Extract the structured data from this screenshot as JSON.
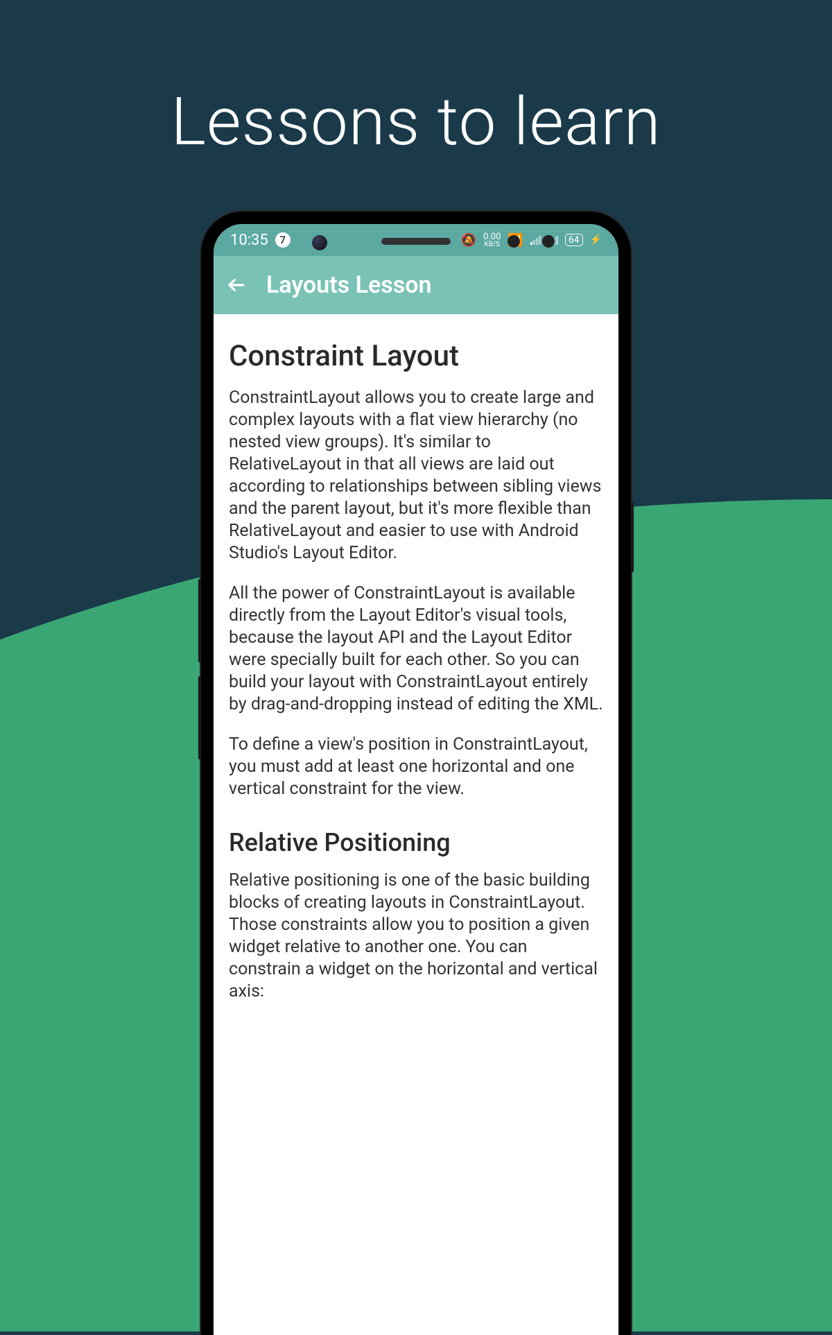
{
  "hero": {
    "title": "Lessons to learn"
  },
  "status": {
    "time": "10:35",
    "notification_count": "7",
    "data_rate": "0.00",
    "data_unit": "KB/S",
    "battery": "64",
    "charging": "⚡"
  },
  "appbar": {
    "title": "Layouts Lesson"
  },
  "lesson": {
    "heading": "Constraint Layout",
    "p1": "ConstraintLayout allows you to create large and complex layouts with a flat view hierarchy (no nested view groups). It's similar to RelativeLayout in that all views are laid out according to relationships between sibling views and the parent layout, but it's more flexible than RelativeLayout and easier to use with Android Studio's Layout Editor.",
    "p2": "All the power of ConstraintLayout is available directly from the Layout Editor's visual tools, because the layout API and the Layout Editor were specially built for each other. So you can build your layout with ConstraintLayout entirely by drag-and-dropping instead of editing the XML.",
    "p3": "To define a view's position in ConstraintLayout, you must add at least one horizontal and one vertical constraint for the view.",
    "sub": "Relative Positioning",
    "p4": "Relative positioning is one of the basic building blocks of creating layouts in ConstraintLayout. Those constraints allow you to position a given widget relative to another one. You can constrain a widget on the horizontal and vertical axis:"
  }
}
